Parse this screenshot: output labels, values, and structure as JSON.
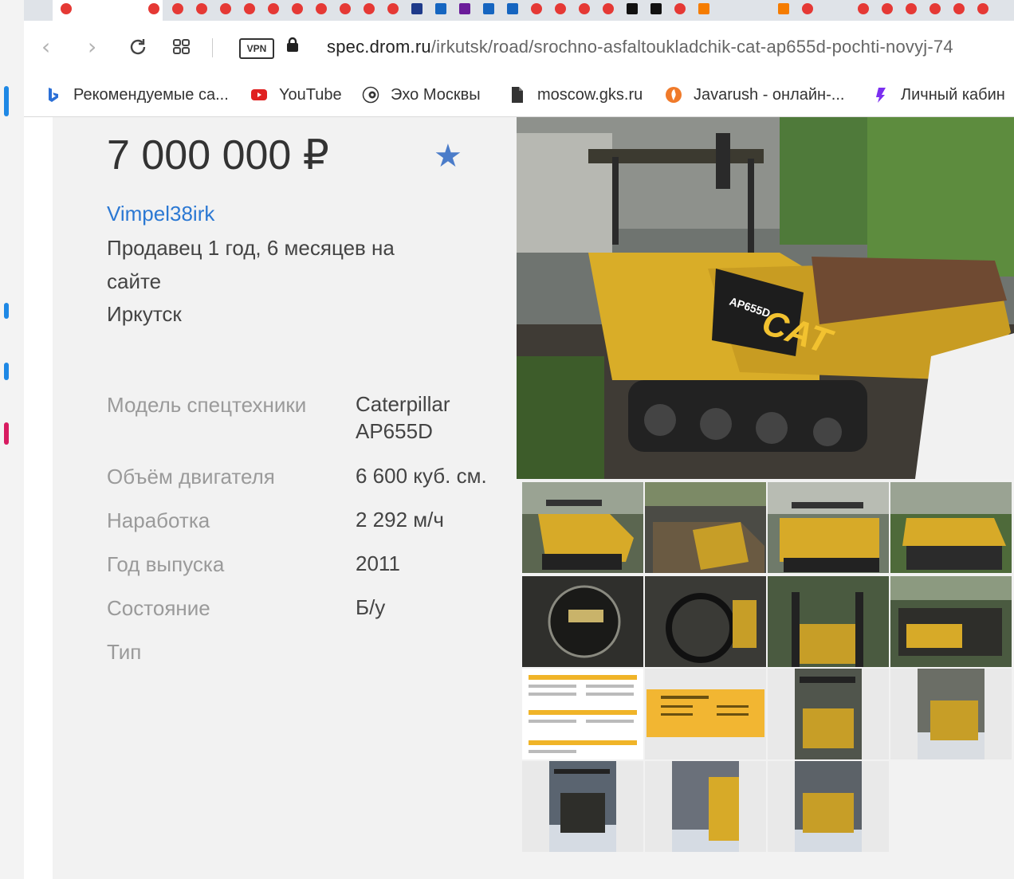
{
  "browser": {
    "url_host": "spec.drom.ru",
    "url_path": "/irkutsk/road/srochno-asfaltoukladchik-cat-ap655d-pochti-novyj-74",
    "vpn_label": "VPN",
    "bookmarks": [
      {
        "label": "Рекомендуемые са...",
        "icon": "bing-icon",
        "color": "#2b6fd6"
      },
      {
        "label": "YouTube",
        "icon": "youtube-icon",
        "color": "#e02020"
      },
      {
        "label": "Эхо Москвы",
        "icon": "echo-icon",
        "color": "#333333"
      },
      {
        "label": "moscow.gks.ru",
        "icon": "document-icon",
        "color": "#333333"
      },
      {
        "label": "Javarush - онлайн-...",
        "icon": "javarush-icon",
        "color": "#f07a2a"
      },
      {
        "label": "Личный кабин",
        "icon": "cabinet-icon",
        "color": "#7b2ff0"
      }
    ]
  },
  "listing": {
    "price": "7 000 000 ₽",
    "seller_name": "Vimpel38irk",
    "seller_since": "Продавец 1 год, 6 месяцев на сайте",
    "city": "Иркутск",
    "specs": [
      {
        "label": "Модель спецтехники",
        "value": "Caterpillar AP655D"
      },
      {
        "label": "Объём двигателя",
        "value": "6 600 куб. см."
      },
      {
        "label": "Наработка",
        "value": "2 292 м/ч"
      },
      {
        "label": "Год выпуска",
        "value": "2011"
      },
      {
        "label": "Состояние",
        "value": "Б/у"
      },
      {
        "label": "Тип",
        "value": ""
      }
    ],
    "main_photo_badge": "AP655D",
    "main_photo_brand": "CAT"
  },
  "colors": {
    "accent": "#2b78d3",
    "star": "#4b7cc9",
    "machine_yellow": "#e0b12a"
  }
}
